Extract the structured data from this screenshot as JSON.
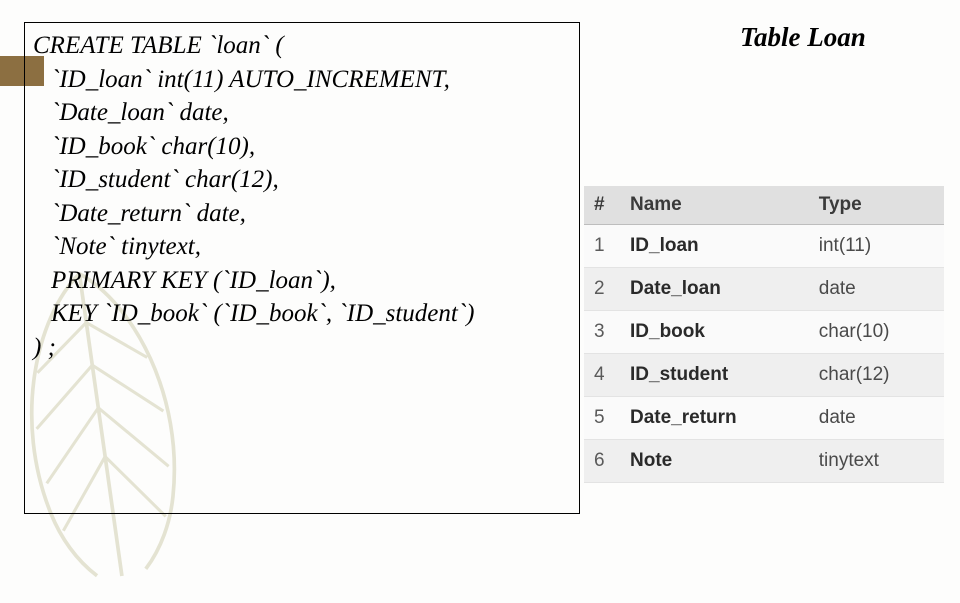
{
  "title": "Table Loan",
  "sql": {
    "line1": "CREATE TABLE `loan` (",
    "cols": [
      "`ID_loan` int(11) AUTO_INCREMENT,",
      "`Date_loan` date,",
      "`ID_book` char(10),",
      "`ID_student` char(12),",
      "`Date_return` date,",
      "`Note` tinytext,",
      "PRIMARY KEY (`ID_loan`),",
      "KEY `ID_book` (`ID_book`, `ID_student`)"
    ],
    "end": ") ;"
  },
  "table": {
    "headers": {
      "num": "#",
      "name": "Name",
      "type": "Type"
    },
    "rows": [
      {
        "n": "1",
        "name": "ID_loan",
        "type": "int(11)"
      },
      {
        "n": "2",
        "name": "Date_loan",
        "type": "date"
      },
      {
        "n": "3",
        "name": "ID_book",
        "type": "char(10)"
      },
      {
        "n": "4",
        "name": "ID_student",
        "type": "char(12)"
      },
      {
        "n": "5",
        "name": "Date_return",
        "type": "date"
      },
      {
        "n": "6",
        "name": "Note",
        "type": "tinytext"
      }
    ]
  }
}
